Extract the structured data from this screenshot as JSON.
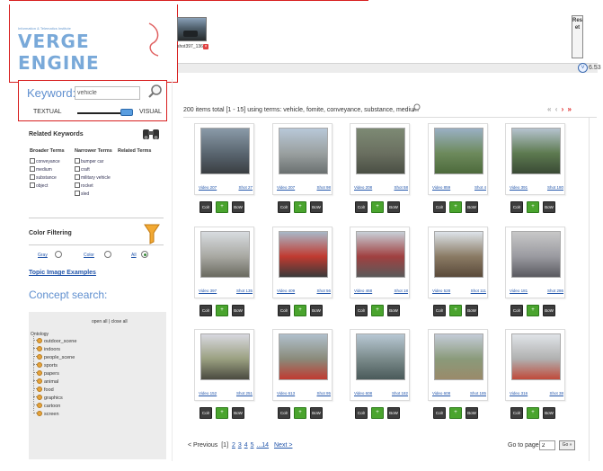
{
  "header": {
    "logo_subtitle": "Information & Telematics Institute",
    "logo_text": "VERGE ENGINE",
    "selected_shot_caption": "shot397_136",
    "reset_label": "Reset",
    "shot_count": "6.53"
  },
  "search": {
    "keyword_label": "Keyword:",
    "keyword_value": "vehicle",
    "textual_label": "TEXTUAL",
    "visual_label": "VISUAL"
  },
  "related": {
    "title": "Related Keywords",
    "headers": [
      "Broader Terms",
      "Narrower Terms",
      "Related Terms"
    ],
    "broader": [
      "conveyance",
      "medium",
      "substance",
      "object"
    ],
    "narrower": [
      "bumper car",
      "craft",
      "military vehicle",
      "rocket",
      "sled"
    ]
  },
  "color_filter": {
    "title": "Color Filtering",
    "options": [
      "Gray",
      "Color",
      "All"
    ],
    "selected": "All"
  },
  "topic_link": "Topic Image Examples",
  "concept": {
    "title": "Concept search:",
    "open_close": "open all | close all",
    "root": "Ontology",
    "items": [
      "outdoor_scene",
      "indoors",
      "people_scene",
      "sports",
      "papers",
      "animal",
      "food",
      "graphics",
      "cartoon",
      "screen"
    ]
  },
  "results": {
    "summary": "200 items total [1 - 15] using terms: vehicle, fomite, conveyance, substance, medium",
    "nav": "« ‹ › »",
    "buttons": {
      "color": "Colr",
      "mid": "+",
      "bow": "BoW"
    },
    "cards": [
      {
        "video": "Video 207",
        "shot": "Shot 27"
      },
      {
        "video": "Video 207",
        "shot": "Shot 98"
      },
      {
        "video": "Video 208",
        "shot": "Shot 58"
      },
      {
        "video": "Video 859",
        "shot": "Shot 4"
      },
      {
        "video": "Video 391",
        "shot": "Shot 180"
      },
      {
        "video": "Video 397",
        "shot": "Shot 135"
      },
      {
        "video": "Video 409",
        "shot": "Shot 56"
      },
      {
        "video": "Video 468",
        "shot": "Shot 18"
      },
      {
        "video": "Video 528",
        "shot": "Shot 111"
      },
      {
        "video": "Video 181",
        "shot": "Shot 286"
      },
      {
        "video": "Video 152",
        "shot": "Shot 251"
      },
      {
        "video": "Video 613",
        "shot": "Shot 95"
      },
      {
        "video": "Video 608",
        "shot": "Shot 182"
      },
      {
        "video": "Video 608",
        "shot": "Shot 185"
      },
      {
        "video": "Video 316",
        "shot": "Shot 38"
      }
    ]
  },
  "pager": {
    "previous": "< Previous",
    "current": "[1]",
    "pages": [
      "2",
      "3",
      "4",
      "5",
      "...14"
    ],
    "next": "Next >",
    "goto_label": "Go to page:",
    "goto_value": "2",
    "go_button": "Go »"
  }
}
